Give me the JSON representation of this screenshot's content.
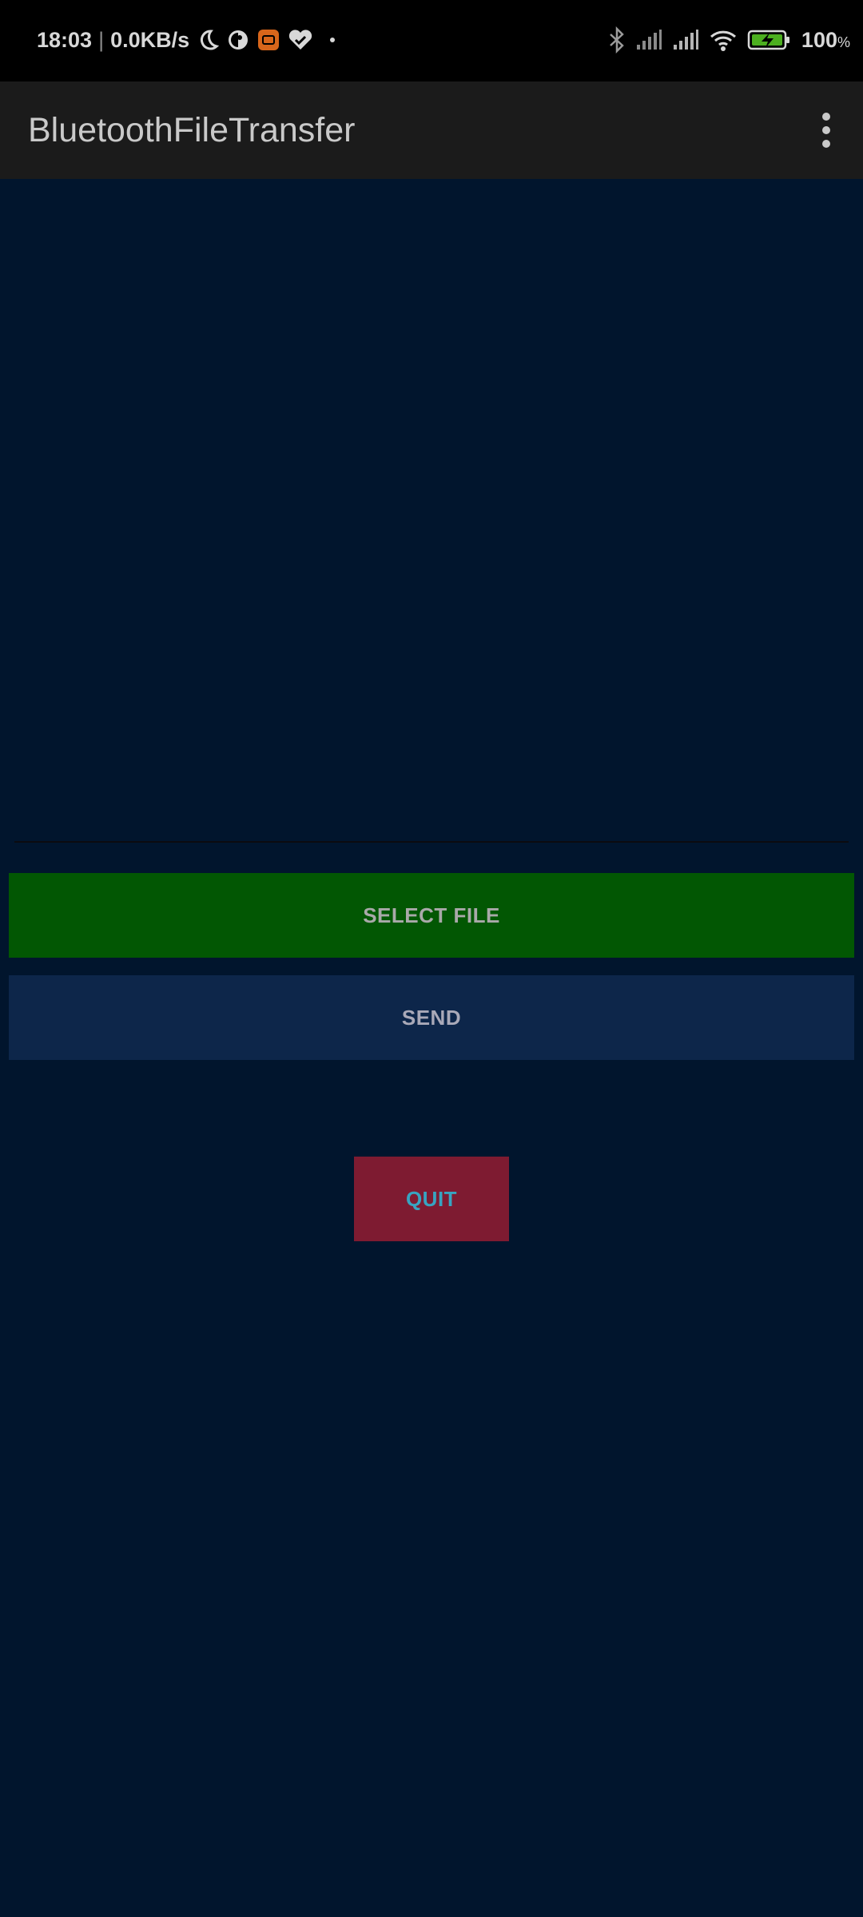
{
  "status_bar": {
    "time": "18:03",
    "separator": "|",
    "speed": "0.0KB/s",
    "battery_percent": "100",
    "battery_suffix": "%",
    "left_icons": [
      "moon-icon",
      "circle-half-icon",
      "app-badge-icon",
      "heart-check-icon",
      "dot-icon"
    ],
    "right_icons": [
      "bluetooth-icon",
      "signal-icon",
      "signal-icon",
      "wifi-icon",
      "battery-charging-icon"
    ]
  },
  "app_bar": {
    "title": "BluetoothFileTransfer",
    "menu_icon": "more-vertical-icon"
  },
  "buttons": {
    "select_file": "SELECT FILE",
    "send": "SEND",
    "quit": "QUIT"
  },
  "colors": {
    "background": "#01152d",
    "select_file_bg": "#025703",
    "send_bg": "#0d264a",
    "quit_bg": "#7e1b31",
    "quit_text": "#38a4c1"
  }
}
